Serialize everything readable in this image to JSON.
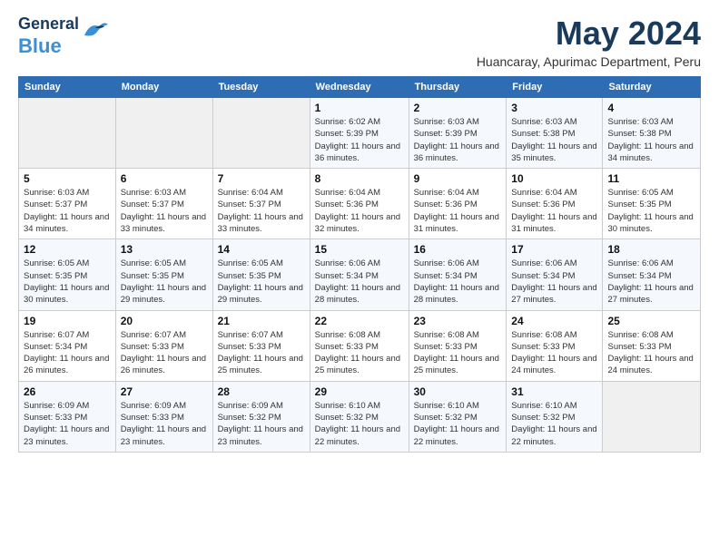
{
  "logo": {
    "line1": "General",
    "line2": "Blue"
  },
  "title": {
    "month_year": "May 2024",
    "location": "Huancaray, Apurimac Department, Peru"
  },
  "weekdays": [
    "Sunday",
    "Monday",
    "Tuesday",
    "Wednesday",
    "Thursday",
    "Friday",
    "Saturday"
  ],
  "weeks": [
    [
      {
        "day": "",
        "info": ""
      },
      {
        "day": "",
        "info": ""
      },
      {
        "day": "",
        "info": ""
      },
      {
        "day": "1",
        "info": "Sunrise: 6:02 AM\nSunset: 5:39 PM\nDaylight: 11 hours and 36 minutes."
      },
      {
        "day": "2",
        "info": "Sunrise: 6:03 AM\nSunset: 5:39 PM\nDaylight: 11 hours and 36 minutes."
      },
      {
        "day": "3",
        "info": "Sunrise: 6:03 AM\nSunset: 5:38 PM\nDaylight: 11 hours and 35 minutes."
      },
      {
        "day": "4",
        "info": "Sunrise: 6:03 AM\nSunset: 5:38 PM\nDaylight: 11 hours and 34 minutes."
      }
    ],
    [
      {
        "day": "5",
        "info": "Sunrise: 6:03 AM\nSunset: 5:37 PM\nDaylight: 11 hours and 34 minutes."
      },
      {
        "day": "6",
        "info": "Sunrise: 6:03 AM\nSunset: 5:37 PM\nDaylight: 11 hours and 33 minutes."
      },
      {
        "day": "7",
        "info": "Sunrise: 6:04 AM\nSunset: 5:37 PM\nDaylight: 11 hours and 33 minutes."
      },
      {
        "day": "8",
        "info": "Sunrise: 6:04 AM\nSunset: 5:36 PM\nDaylight: 11 hours and 32 minutes."
      },
      {
        "day": "9",
        "info": "Sunrise: 6:04 AM\nSunset: 5:36 PM\nDaylight: 11 hours and 31 minutes."
      },
      {
        "day": "10",
        "info": "Sunrise: 6:04 AM\nSunset: 5:36 PM\nDaylight: 11 hours and 31 minutes."
      },
      {
        "day": "11",
        "info": "Sunrise: 6:05 AM\nSunset: 5:35 PM\nDaylight: 11 hours and 30 minutes."
      }
    ],
    [
      {
        "day": "12",
        "info": "Sunrise: 6:05 AM\nSunset: 5:35 PM\nDaylight: 11 hours and 30 minutes."
      },
      {
        "day": "13",
        "info": "Sunrise: 6:05 AM\nSunset: 5:35 PM\nDaylight: 11 hours and 29 minutes."
      },
      {
        "day": "14",
        "info": "Sunrise: 6:05 AM\nSunset: 5:35 PM\nDaylight: 11 hours and 29 minutes."
      },
      {
        "day": "15",
        "info": "Sunrise: 6:06 AM\nSunset: 5:34 PM\nDaylight: 11 hours and 28 minutes."
      },
      {
        "day": "16",
        "info": "Sunrise: 6:06 AM\nSunset: 5:34 PM\nDaylight: 11 hours and 28 minutes."
      },
      {
        "day": "17",
        "info": "Sunrise: 6:06 AM\nSunset: 5:34 PM\nDaylight: 11 hours and 27 minutes."
      },
      {
        "day": "18",
        "info": "Sunrise: 6:06 AM\nSunset: 5:34 PM\nDaylight: 11 hours and 27 minutes."
      }
    ],
    [
      {
        "day": "19",
        "info": "Sunrise: 6:07 AM\nSunset: 5:34 PM\nDaylight: 11 hours and 26 minutes."
      },
      {
        "day": "20",
        "info": "Sunrise: 6:07 AM\nSunset: 5:33 PM\nDaylight: 11 hours and 26 minutes."
      },
      {
        "day": "21",
        "info": "Sunrise: 6:07 AM\nSunset: 5:33 PM\nDaylight: 11 hours and 25 minutes."
      },
      {
        "day": "22",
        "info": "Sunrise: 6:08 AM\nSunset: 5:33 PM\nDaylight: 11 hours and 25 minutes."
      },
      {
        "day": "23",
        "info": "Sunrise: 6:08 AM\nSunset: 5:33 PM\nDaylight: 11 hours and 25 minutes."
      },
      {
        "day": "24",
        "info": "Sunrise: 6:08 AM\nSunset: 5:33 PM\nDaylight: 11 hours and 24 minutes."
      },
      {
        "day": "25",
        "info": "Sunrise: 6:08 AM\nSunset: 5:33 PM\nDaylight: 11 hours and 24 minutes."
      }
    ],
    [
      {
        "day": "26",
        "info": "Sunrise: 6:09 AM\nSunset: 5:33 PM\nDaylight: 11 hours and 23 minutes."
      },
      {
        "day": "27",
        "info": "Sunrise: 6:09 AM\nSunset: 5:33 PM\nDaylight: 11 hours and 23 minutes."
      },
      {
        "day": "28",
        "info": "Sunrise: 6:09 AM\nSunset: 5:32 PM\nDaylight: 11 hours and 23 minutes."
      },
      {
        "day": "29",
        "info": "Sunrise: 6:10 AM\nSunset: 5:32 PM\nDaylight: 11 hours and 22 minutes."
      },
      {
        "day": "30",
        "info": "Sunrise: 6:10 AM\nSunset: 5:32 PM\nDaylight: 11 hours and 22 minutes."
      },
      {
        "day": "31",
        "info": "Sunrise: 6:10 AM\nSunset: 5:32 PM\nDaylight: 11 hours and 22 minutes."
      },
      {
        "day": "",
        "info": ""
      }
    ]
  ]
}
